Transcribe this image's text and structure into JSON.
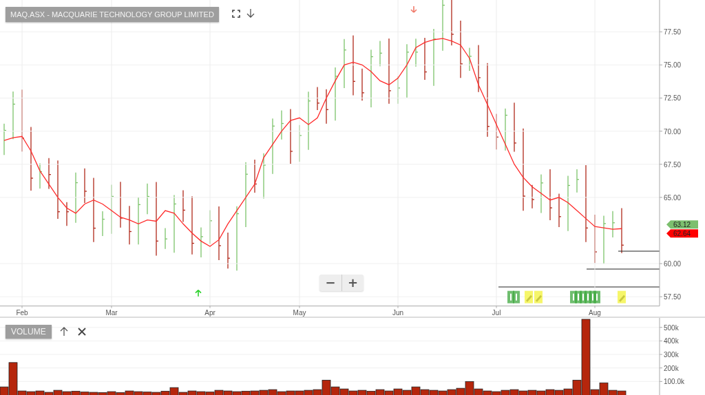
{
  "title": "MAQ.ASX - MACQUARIE TECHNOLOGY GROUP LIMITED",
  "zoom_controls": [
    "−",
    "+"
  ],
  "price_chart": {
    "chart_data": {
      "type": "line",
      "grid": true,
      "ylim": [
        56.8,
        79.9
      ],
      "categories": [
        null,
        null,
        "Feb",
        null,
        null,
        null,
        null,
        null,
        null,
        null,
        null,
        null,
        "Mar",
        null,
        null,
        null,
        null,
        null,
        null,
        null,
        null,
        null,
        null,
        "Apr",
        null,
        null,
        null,
        null,
        null,
        null,
        null,
        null,
        null,
        "May",
        null,
        null,
        null,
        null,
        null,
        null,
        null,
        null,
        null,
        null,
        "Jun",
        null,
        null,
        null,
        null,
        null,
        null,
        null,
        null,
        null,
        null,
        "Jul",
        null,
        null,
        null,
        null,
        null,
        null,
        null,
        null,
        null,
        null,
        "Aug",
        null,
        null,
        null
      ],
      "yticks": [
        {
          "value": 57.5,
          "label": "57.50"
        },
        {
          "value": 60,
          "label": "60.00"
        },
        {
          "value": 65,
          "label": "65.00"
        },
        {
          "value": 67.5,
          "label": "67.50"
        },
        {
          "value": 70,
          "label": "70.00"
        },
        {
          "value": 72.5,
          "label": "72.50"
        },
        {
          "value": 75,
          "label": "75.00"
        },
        {
          "value": 77.5,
          "label": "77.50"
        }
      ],
      "series": [
        {
          "color": "#ff2a2a",
          "values": [
            69.3,
            69.5,
            69.6,
            68.5,
            67,
            66,
            65,
            64.2,
            63.8,
            64.5,
            64.8,
            64.5,
            64,
            63.5,
            63.3,
            63,
            63.3,
            63.2,
            64,
            63.8,
            63,
            62.3,
            61.7,
            61.3,
            61.8,
            63,
            64,
            65,
            66,
            68,
            69,
            70,
            70.8,
            71,
            70.5,
            71,
            72.5,
            73.8,
            75,
            75.2,
            75,
            74.5,
            73.8,
            73.5,
            74,
            75,
            76.3,
            76.7,
            76.9,
            77,
            76.8,
            76.5,
            75.5,
            73.5,
            72,
            70.5,
            69,
            67.5,
            66.5,
            65.8,
            65.3,
            64.8,
            65,
            64.6,
            64,
            63.4,
            62.8,
            62.7,
            62.6,
            62.64
          ]
        }
      ]
    },
    "price_tags": [
      {
        "label": "63.12",
        "color": "#7cbf6e"
      },
      {
        "label": "62.64",
        "color": "#ff0000"
      }
    ]
  },
  "volume_chart": {
    "title": "VOLUME",
    "chart_data": {
      "type": "bar",
      "grid": true,
      "ylim": [
        0,
        570000
      ],
      "yticks": [
        {
          "value": 100000,
          "label": "100.0k"
        },
        {
          "value": 200000,
          "label": "200k"
        },
        {
          "value": 300000,
          "label": "300k"
        },
        {
          "value": 400000,
          "label": "400k"
        },
        {
          "value": 500000,
          "label": "500k"
        }
      ],
      "series": [
        {
          "color": "#b5260c",
          "values": [
            60000,
            240000,
            30000,
            25000,
            30000,
            20000,
            35000,
            25000,
            28000,
            22000,
            20000,
            18000,
            25000,
            18000,
            30000,
            25000,
            22000,
            20000,
            28000,
            55000,
            20000,
            30000,
            25000,
            22000,
            35000,
            30000,
            25000,
            28000,
            30000,
            35000,
            40000,
            25000,
            30000,
            30000,
            35000,
            40000,
            110000,
            60000,
            45000,
            30000,
            35000,
            28000,
            40000,
            30000,
            45000,
            35000,
            60000,
            40000,
            35000,
            30000,
            40000,
            50000,
            100000,
            45000,
            30000,
            25000,
            35000,
            40000,
            30000,
            35000,
            30000,
            40000,
            35000,
            45000,
            110000,
            560000,
            40000,
            90000,
            35000,
            30000
          ]
        }
      ]
    }
  }
}
